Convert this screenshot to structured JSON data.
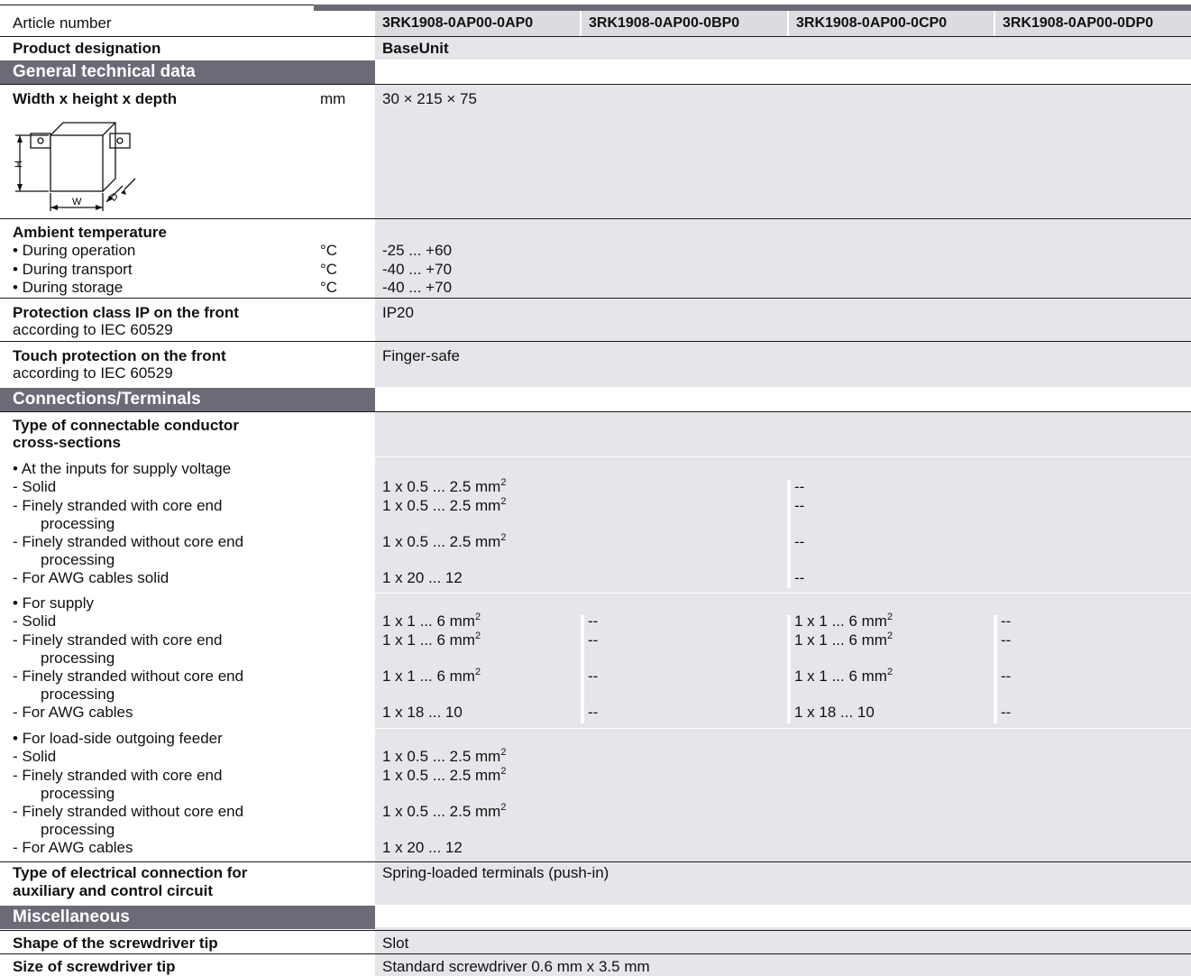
{
  "header": {
    "article_label": "Article number",
    "articles": [
      "3RK1908-0AP00-0AP0",
      "3RK1908-0AP00-0BP0",
      "3RK1908-0AP00-0CP0",
      "3RK1908-0AP00-0DP0"
    ],
    "designation_label": "Product designation",
    "designation_value": "BaseUnit"
  },
  "sections": {
    "general": "General technical data",
    "connections": "Connections/Terminals",
    "misc": "Miscellaneous"
  },
  "general": {
    "whd_label": "Width x height x depth",
    "whd_unit": "mm",
    "whd_value": "30 × 215 × 75",
    "diagram": {
      "h": "H",
      "w": "W",
      "d": "D"
    },
    "ambient_label": "Ambient temperature",
    "ambient_rows": [
      {
        "label": "• During operation",
        "unit": "°C",
        "value": "-25 ... +60"
      },
      {
        "label": "• During transport",
        "unit": "°C",
        "value": "-40 ... +70"
      },
      {
        "label": "• During storage",
        "unit": "°C",
        "value": "-40 ... +70"
      }
    ],
    "ip_label": "Protection class IP on the front",
    "ip_sub": "according to IEC 60529",
    "ip_value": "IP20",
    "touch_label": "Touch protection on the front",
    "touch_sub": "according to IEC 60529",
    "touch_value": "Finger-safe"
  },
  "connections": {
    "type_label_1": "Type of connectable conductor",
    "type_label_2": "cross-sections",
    "inputs": {
      "label": "• At the inputs for supply voltage",
      "solid": "- Solid",
      "fine_with_1": "- Finely stranded with core end",
      "fine_with_2": "processing",
      "fine_without_1": "- Finely stranded without core end",
      "fine_without_2": "processing",
      "awg": "- For AWG cables solid",
      "v_solid": "1 x 0.5 ... 2.5 mm",
      "v_fine_with": "1 x 0.5 ... 2.5 mm",
      "v_fine_without": "1 x 0.5 ... 2.5 mm",
      "v_awg": "1 x 20 ... 12",
      "sq": "2",
      "dash": "--"
    },
    "supply": {
      "label": "• For supply",
      "solid": "- Solid",
      "fine_with_1": "- Finely stranded with core end",
      "fine_with_2": "processing",
      "fine_without_1": "- Finely stranded without core end",
      "fine_without_2": "processing",
      "awg": "- For AWG cables",
      "v_solid": "1 x 1 ... 6 mm",
      "v_fine_with": "1 x 1 ... 6 mm",
      "v_fine_without": "1 x 1 ... 6 mm",
      "v_awg": "1 x 18 ... 10",
      "sq": "2",
      "dash": "--"
    },
    "load": {
      "label": "• For load-side outgoing feeder",
      "solid": "- Solid",
      "fine_with_1": "- Finely stranded with core end",
      "fine_with_2": "processing",
      "fine_without_1": "- Finely stranded without core end",
      "fine_without_2": "processing",
      "awg": "- For AWG cables",
      "v_solid": "1 x 0.5 ... 2.5 mm",
      "v_fine_with": "1 x 0.5 ... 2.5 mm",
      "v_fine_without": "1 x 0.5 ... 2.5 mm",
      "v_awg": "1 x 20 ... 12",
      "sq": "2"
    },
    "elec_label_1": "Type of electrical connection for",
    "elec_label_2": "auxiliary and control circuit",
    "elec_value": "Spring-loaded terminals (push-in)"
  },
  "misc": {
    "shape_label": "Shape of the screwdriver tip",
    "shape_value": "Slot",
    "size_label": "Size of screwdriver tip",
    "size_value": "Standard screwdriver 0.6 mm x 3.5 mm"
  }
}
